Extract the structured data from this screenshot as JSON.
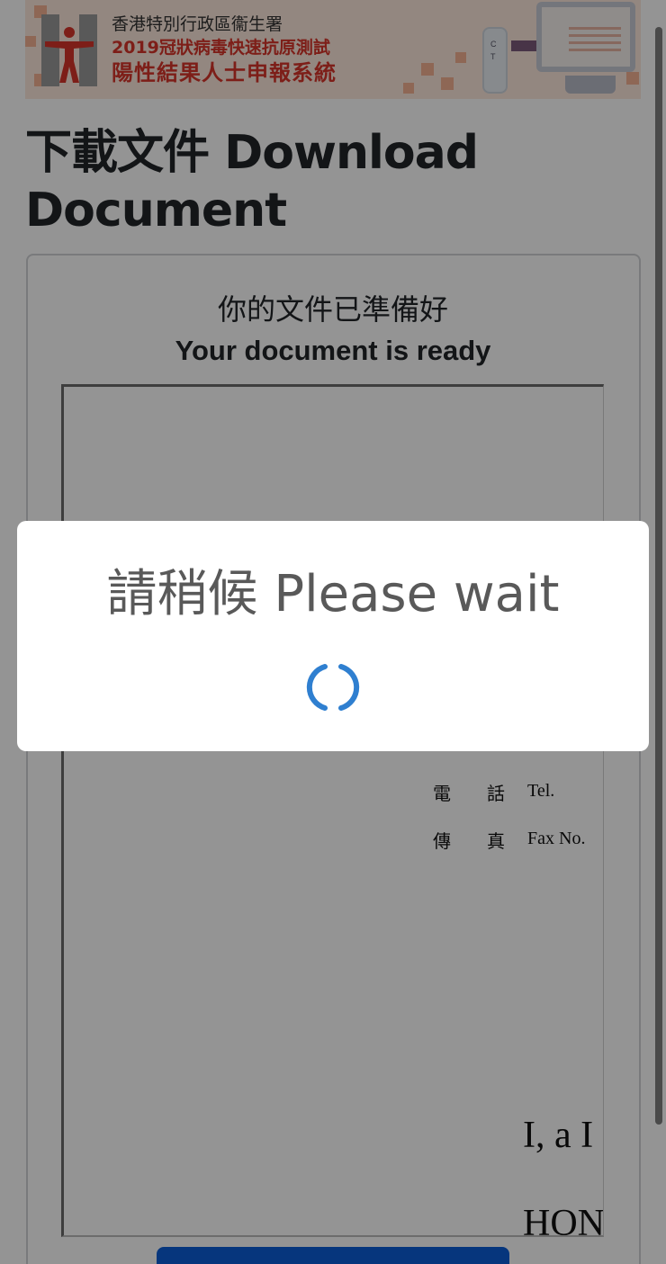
{
  "banner": {
    "line1": "香港特別行政區衞生署",
    "line2": "2019冠狀病毒快速抗原測試",
    "line3": "陽性結果人士申報系統",
    "kit_label_c": "C",
    "kit_label_t": "T",
    "accent_color": "#d8342a"
  },
  "page": {
    "title": "下載文件 Download Document"
  },
  "card": {
    "ready_zh": "你的文件已準備好",
    "ready_en": "Your document is ready"
  },
  "document": {
    "tel_zh": "電　　話",
    "tel_en": "Tel.",
    "fax_zh": "傳　　真",
    "fax_en": "Fax No.",
    "body_line1": "I, a I",
    "body_line2": "HON"
  },
  "modal": {
    "title": "請稍候 Please wait",
    "spinner_icon": "loading-spinner-icon",
    "spinner_color": "#2f7fd0"
  },
  "download_button": {
    "color": "#0b5ed7"
  }
}
